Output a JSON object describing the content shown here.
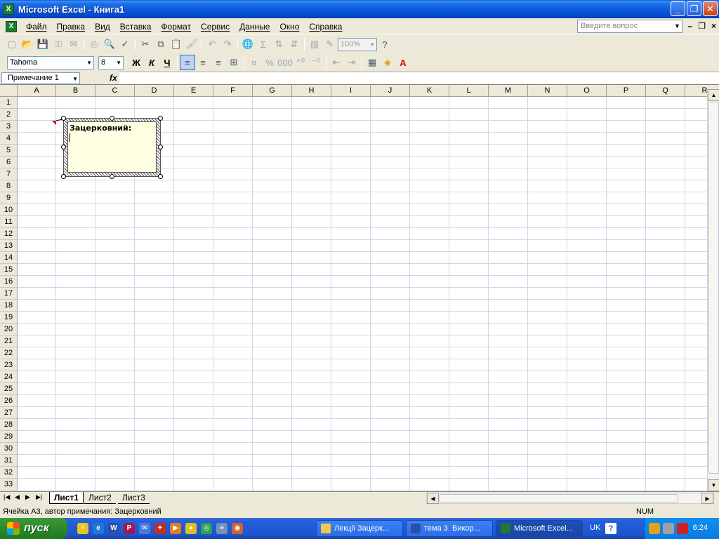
{
  "window": {
    "title": "Microsoft Excel - Книга1"
  },
  "menu": {
    "items": [
      "Файл",
      "Правка",
      "Вид",
      "Вставка",
      "Формат",
      "Сервис",
      "Данные",
      "Окно",
      "Справка"
    ],
    "help_placeholder": "Введите вопрос"
  },
  "toolbar": {
    "zoom": "100%",
    "font_name": "Tahoma",
    "font_size": "8",
    "bold_label": "Ж",
    "italic_label": "К",
    "underline_label": "Ч"
  },
  "formula_bar": {
    "name_box": "Примечание 1",
    "fx_label": "fx"
  },
  "grid": {
    "columns": [
      "A",
      "B",
      "C",
      "D",
      "E",
      "F",
      "G",
      "H",
      "I",
      "J",
      "K",
      "L",
      "M",
      "N",
      "O",
      "P",
      "Q",
      "R"
    ],
    "rows": [
      "1",
      "2",
      "3",
      "4",
      "5",
      "6",
      "7",
      "8",
      "9",
      "10",
      "11",
      "12",
      "13",
      "14",
      "15",
      "16",
      "17",
      "18",
      "19",
      "20",
      "21",
      "22",
      "23",
      "24",
      "25",
      "26",
      "27",
      "28",
      "29",
      "30",
      "31",
      "32",
      "33"
    ]
  },
  "comment": {
    "author": "Зацерковний:"
  },
  "sheets": {
    "tabs": [
      "Лист1",
      "Лист2",
      "Лист3"
    ],
    "active": "Лист1"
  },
  "status": {
    "text": "Ячейка A3, автор примечания: Зацерковний",
    "num": "NUM"
  },
  "taskbar": {
    "start_label": "пуск",
    "buttons": [
      "Лекції Зацерк...",
      "тема 3. Викор...",
      "Microsoft Excel..."
    ],
    "lang": "UK",
    "clock": "6:24"
  },
  "colors": {
    "accent": "#0A5FD8",
    "comment_bg": "#FFFFE1",
    "sheet_bg": "#ECE9D8"
  }
}
